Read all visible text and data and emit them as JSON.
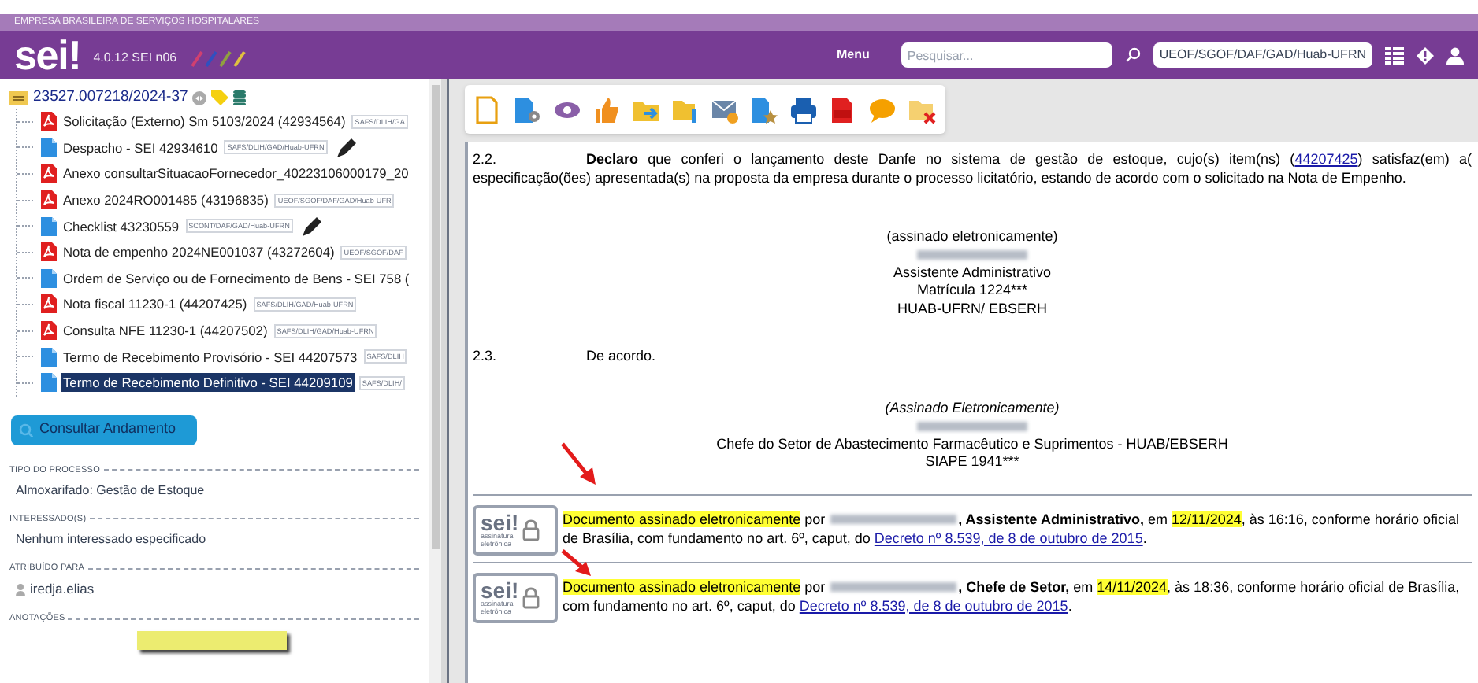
{
  "header": {
    "org": "EMPRESA BRASILEIRA DE SERVIÇOS HOSPITALARES",
    "logo": "sei!",
    "version": "4.0.12 SEI n06",
    "menu": "Menu",
    "search": {
      "placeholder": "Pesquisar..."
    },
    "unit": "UEOF/SGOF/DAF/GAD/Huab-UFRN"
  },
  "tree": {
    "process": "23527.007218/2024-37",
    "documents": [
      {
        "kind": "pdf",
        "title": "Solicitação (Externo) Sm 5103/2024 (42934564)",
        "unit": "SAFS/DLIH/GA",
        "pen": false,
        "selected": false
      },
      {
        "kind": "doc",
        "title": "Despacho - SEI 42934610",
        "unit": "SAFS/DLIH/GAD/Huab-UFRN",
        "pen": true,
        "selected": false
      },
      {
        "kind": "pdf",
        "title": "Anexo consultarSituacaoFornecedor_40223106000179_20",
        "pen": false,
        "selected": false
      },
      {
        "kind": "pdf",
        "title": "Anexo 2024RO001485 (43196835)",
        "unit": "UEOF/SGOF/DAF/GAD/Huab-UFR",
        "pen": false,
        "selected": false
      },
      {
        "kind": "doc",
        "title": "Checklist 43230559",
        "unit": "SCONT/DAF/GAD/Huab-UFRN",
        "pen": true,
        "selected": false
      },
      {
        "kind": "pdf",
        "title": "Nota de empenho 2024NE001037 (43272604)",
        "unit": "UEOF/SGOF/DAF",
        "pen": false,
        "selected": false
      },
      {
        "kind": "doc",
        "title": "Ordem de Serviço ou de Fornecimento de Bens - SEI 758 (",
        "pen": false,
        "selected": false
      },
      {
        "kind": "pdf",
        "title": "Nota fiscal 11230-1 (44207425)",
        "unit": "SAFS/DLIH/GAD/Huab-UFRN",
        "pen": false,
        "selected": false
      },
      {
        "kind": "pdf",
        "title": "Consulta NFE 11230-1 (44207502)",
        "unit": "SAFS/DLIH/GAD/Huab-UFRN",
        "pen": false,
        "selected": false
      },
      {
        "kind": "doc",
        "title": "Termo de Recebimento Provisório - SEI 44207573",
        "unit": "SAFS/DLIH",
        "pen": false,
        "selected": false
      },
      {
        "kind": "doc",
        "title": "Termo de Recebimento Definitivo - SEI 44209109",
        "unit": "SAFS/DLIH/",
        "pen": false,
        "selected": true
      }
    ]
  },
  "consult_button": "Consultar Andamento",
  "info": [
    {
      "kind": "text",
      "label": "TIPO DO PROCESSO",
      "value": "Almoxarifado: Gestão de Estoque"
    },
    {
      "kind": "text",
      "label": "INTERESSADO(S)",
      "value": "Nenhum interessado especificado"
    },
    {
      "kind": "user",
      "label": "ATRIBUÍDO PARA",
      "value": "iredja.elias"
    },
    {
      "kind": "note",
      "label": "ANOTAÇÕES"
    }
  ],
  "document": {
    "paragraphs": [
      {
        "number": "2.2.",
        "parts": [
          {
            "kind": "bold",
            "text": "Declaro"
          },
          {
            "kind": "plain",
            "text": " que conferi o lançamento deste Danfe no sistema de gestão de estoque, cujo(s) item(ns) ("
          },
          {
            "kind": "link",
            "text": "44207425"
          },
          {
            "kind": "plain",
            "text": ") satisfaz(em) a( especificação(ões) apresentada(s) na proposta da empresa durante o processo licitatório, estando de acordo com o solicitado na Nota de Empenho."
          }
        ],
        "block": [
          {
            "kind": "plain",
            "text": "(assinado eletronicamente)"
          },
          {
            "kind": "redacted"
          },
          {
            "kind": "plain",
            "text": "Assistente Administrativo"
          },
          {
            "kind": "plain",
            "text": "Matrícula 1224***"
          },
          {
            "kind": "plain",
            "text": "HUAB-UFRN/ EBSERH"
          }
        ]
      },
      {
        "number": "2.3.",
        "parts": [
          {
            "kind": "plain",
            "text": "De acordo."
          }
        ],
        "block": [
          {
            "kind": "italic",
            "text": "(Assinado Eletronicamente)"
          },
          {
            "kind": "redacted"
          },
          {
            "kind": "plain",
            "text": "Chefe do Setor de Abastecimento Farmacêutico e Suprimentos - HUAB/EBSERH"
          },
          {
            "kind": "plain",
            "text": "SIAPE 1941***"
          }
        ]
      }
    ],
    "signatures": [
      {
        "stamp_logo": "sei!",
        "stamp_caption": "assinatura eletrônica",
        "parts": [
          {
            "kind": "mark",
            "text": "Documento assinado eletronicamente"
          },
          {
            "kind": "plain",
            "text": " por "
          },
          {
            "kind": "redacted"
          },
          {
            "kind": "bold",
            "text": ", Assistente Administrativo,"
          },
          {
            "kind": "plain",
            "text": " em "
          },
          {
            "kind": "mark",
            "text": "12/11/2024"
          },
          {
            "kind": "plain",
            "text": ", às 16:16, conforme horário oficial de Brasília, com fundamento no art. 6º, caput, do "
          },
          {
            "kind": "link",
            "text": "Decreto nº 8.539, de 8 de outubro de 2015"
          },
          {
            "kind": "plain",
            "text": "."
          }
        ]
      },
      {
        "stamp_logo": "sei!",
        "stamp_caption": "assinatura eletrônica",
        "parts": [
          {
            "kind": "mark",
            "text": "Documento assinado eletronicamente"
          },
          {
            "kind": "plain",
            "text": " por "
          },
          {
            "kind": "redacted"
          },
          {
            "kind": "bold",
            "text": ", Chefe de Setor,"
          },
          {
            "kind": "plain",
            "text": " em "
          },
          {
            "kind": "mark",
            "text": "14/11/2024"
          },
          {
            "kind": "plain",
            "text": ", às 18:36, conforme horário oficial de Brasília, com fundamento no art. 6º, caput, do "
          },
          {
            "kind": "link",
            "text": "Decreto nº 8.539, de 8 de outubro de 2015"
          },
          {
            "kind": "plain",
            "text": "."
          }
        ]
      }
    ]
  }
}
